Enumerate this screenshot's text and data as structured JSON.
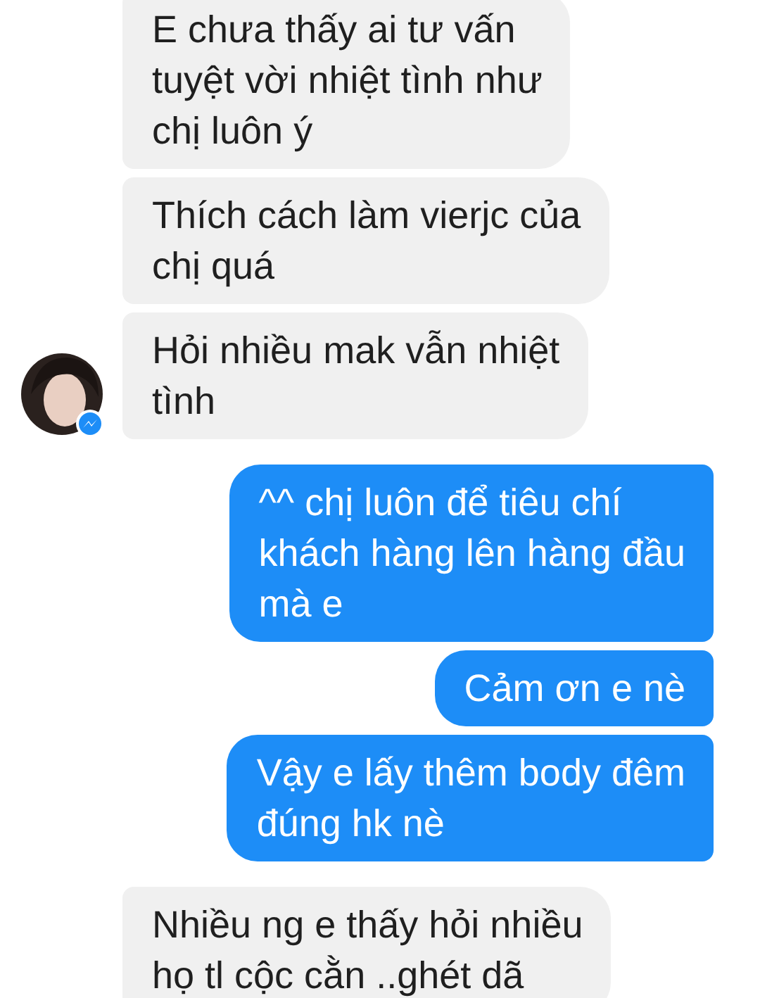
{
  "messages": [
    {
      "kind": "received",
      "lines": [
        "E chưa thấy ai tư vấn",
        "tuyệt vời nhiệt tình như",
        "chị luôn ý"
      ],
      "avatar": false
    },
    {
      "kind": "received",
      "lines": [
        "Thích cách làm vierjc của",
        "chị quá"
      ],
      "avatar": false
    },
    {
      "kind": "received",
      "lines": [
        "Hỏi nhiều mak vẫn nhiệt",
        "tình"
      ],
      "avatar": true
    },
    {
      "kind": "sent",
      "lines": [
        "^^ chị luôn để tiêu chí",
        "khách hàng lên hàng đầu",
        "mà e"
      ],
      "avatar": false
    },
    {
      "kind": "sent",
      "lines": [
        "Cảm ơn e nè"
      ],
      "avatar": false
    },
    {
      "kind": "sent",
      "lines": [
        "Vậy e lấy thêm body đêm",
        "đúng hk nè"
      ],
      "avatar": false
    },
    {
      "kind": "received",
      "lines": [
        "Nhiều ng e thấy hỏi nhiều",
        "họ tl cộc cằn ..ghét dã"
      ],
      "avatar": false
    }
  ]
}
